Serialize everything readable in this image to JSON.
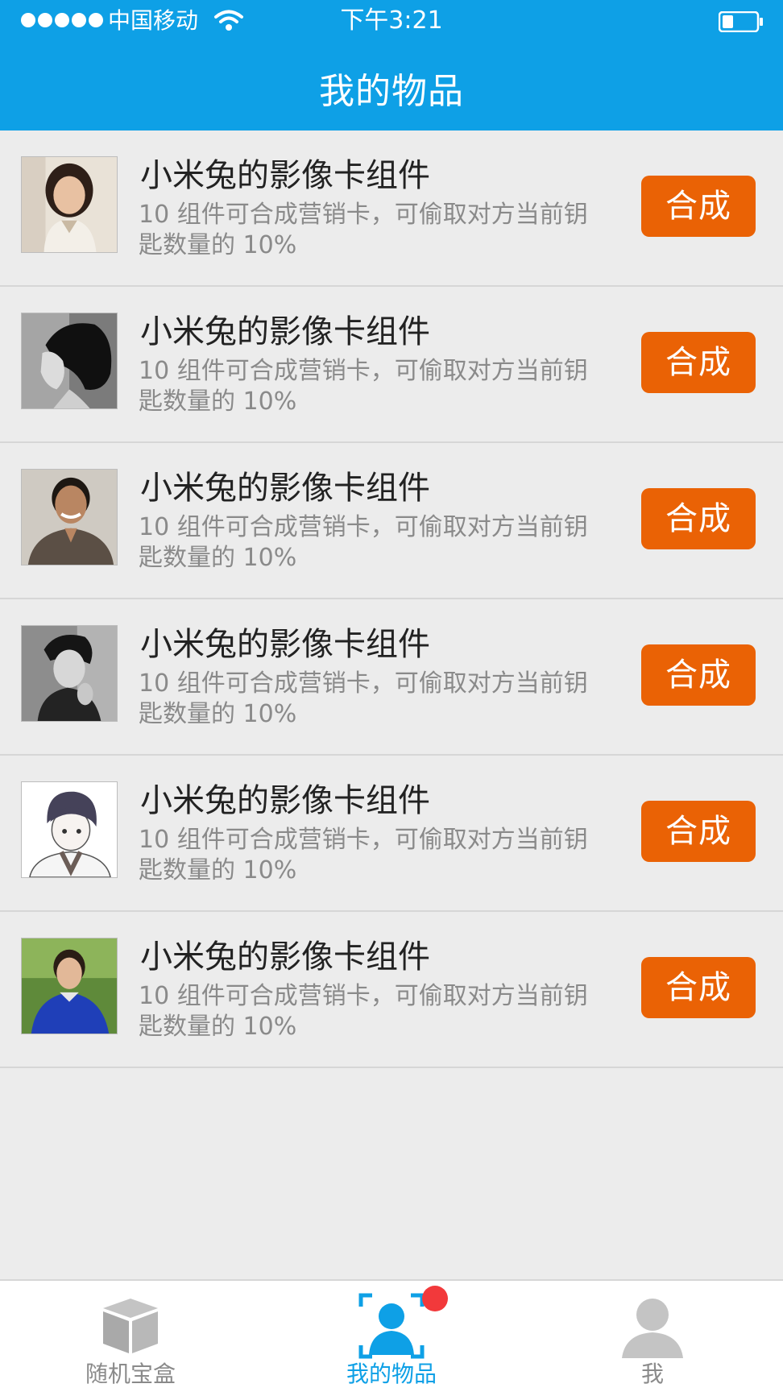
{
  "status_bar": {
    "carrier": "中国移动",
    "time": "下午3:21",
    "signal_bars": 5
  },
  "header": {
    "title": "我的物品"
  },
  "items": [
    {
      "title": "小米兔的影像卡组件",
      "desc": "10 组件可合成营销卡，可偷取对方当前钥匙数量的 10%",
      "button": "合成",
      "avatar": "avatar-woman-smiling"
    },
    {
      "title": "小米兔的影像卡组件",
      "desc": "10 组件可合成营销卡，可偷取对方当前钥匙数量的 10%",
      "button": "合成",
      "avatar": "avatar-woman-bob-hair"
    },
    {
      "title": "小米兔的影像卡组件",
      "desc": "10 组件可合成营销卡，可偷取对方当前钥匙数量的 10%",
      "button": "合成",
      "avatar": "avatar-man-smiling"
    },
    {
      "title": "小米兔的影像卡组件",
      "desc": "10 组件可合成营销卡，可偷取对方当前钥匙数量的 10%",
      "button": "合成",
      "avatar": "avatar-man-bw"
    },
    {
      "title": "小米兔的影像卡组件",
      "desc": "10 组件可合成营销卡，可偷取对方当前钥匙数量的 10%",
      "button": "合成",
      "avatar": "avatar-anime-boy"
    },
    {
      "title": "小米兔的影像卡组件",
      "desc": "10 组件可合成营销卡，可偷取对方当前钥匙数量的 10%",
      "button": "合成",
      "avatar": "avatar-boy-outdoor"
    }
  ],
  "tabbar": {
    "tabs": [
      {
        "label": "随机宝盒",
        "icon": "box-icon",
        "active": false
      },
      {
        "label": "我的物品",
        "icon": "user-scan-icon",
        "active": true
      },
      {
        "label": "我",
        "icon": "person-icon",
        "active": false
      }
    ],
    "badge_color": "#f2393b"
  },
  "colors": {
    "header_blue": "#0ea0e6",
    "button_orange": "#ea6205",
    "background": "#ececec"
  }
}
